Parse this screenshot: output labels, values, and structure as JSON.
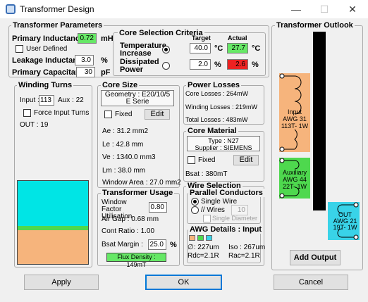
{
  "window": {
    "title": "Transformer Design",
    "minimize": "—",
    "maximize": "☐",
    "close": "✕"
  },
  "params": {
    "label": "Transformer Parameters",
    "primary_inductance_label": "Primary Inductance",
    "primary_inductance_value": "0.72",
    "primary_inductance_unit": "mH",
    "user_defined": "User Defined",
    "leakage_label": "Leakage Inductance",
    "leakage_value": "3.0",
    "leakage_unit": "%",
    "capacitance_label": "Primary Capacitance",
    "capacitance_value": "30",
    "capacitance_unit": "pF"
  },
  "criteria": {
    "label": "Core Selection Criteria",
    "target_header": "Target",
    "actual_header": "Actual",
    "temp_label": "Temperature Increase",
    "temp_target": "40.0",
    "temp_unit": "°C",
    "temp_actual": "27.7",
    "temp_actual_unit": "°C",
    "power_label": "Dissipated Power",
    "power_target": "2.0",
    "power_unit": "%",
    "power_actual": "2.6",
    "power_actual_unit": "%",
    "ok_color": "#66e866",
    "bad_color": "#ee2222"
  },
  "winding": {
    "label": "Winding Turns",
    "input_label": "Input :",
    "input_value": "113",
    "aux_label": "Aux : 22",
    "force_label": "Force Input Turns",
    "out_label": "OUT : 19"
  },
  "core_size": {
    "label": "Core Size",
    "geometry": "Geometry : E20/10/5",
    "serie": "E Serie",
    "fixed_label": "Fixed",
    "edit_label": "Edit",
    "ae": "Ae : 31.2 mm2",
    "le": "Le : 42.8 mm",
    "ve": "Ve : 1340.0 mm3",
    "lm": "Lm : 38.0 mm",
    "window_area": "Window Area : 27.0 mm2"
  },
  "losses": {
    "label": "Power Losses",
    "core": "Core Losses : 264mW",
    "winding": "Winding Losses : 219mW",
    "total": "Total Losses : 483mW"
  },
  "material": {
    "label": "Core Material",
    "type": "Type : N27",
    "supplier": "Supplier : SIEMENS",
    "fixed_label": "Fixed",
    "edit_label": "Edit",
    "bsat": "Bsat : 380mT"
  },
  "usage": {
    "label": "Transformer Usage",
    "wf_label": "Window Factor Utilisation",
    "wf_value": "0.80",
    "air_gap": "Air Gap : 0.68 mm",
    "cont_ratio": "Cont Ratio : 1.00",
    "bsat_margin_label": "Bsat Margin :",
    "bsat_margin_value": "25.0",
    "bsat_margin_unit": "%",
    "flux": "Flux Density : 149mT"
  },
  "wire": {
    "label": "Wire Selection",
    "parallel_label": "Parallel Conductors",
    "single_wire": "Single Wire",
    "wires_label": "// Wires",
    "wires_value": "10",
    "single_diameter": "Single Diameter",
    "awg_label": "AWG Details : Input",
    "awg_diam": "∅: 227um",
    "awg_iso": "Iso : 267um",
    "rdc": "Rdc=2.1R",
    "rac": "Rac=2.1R",
    "swatch_colors": [
      "#f6b47c",
      "#4ed84e",
      "#39d3e8"
    ]
  },
  "outlook": {
    "label": "Transformer Outlook",
    "input_lines": [
      "Input",
      "AWG 31",
      "113T- 1W"
    ],
    "aux_lines": [
      "Auxiliary",
      "AWG 44",
      "22T- 1W"
    ],
    "out_lines": [
      "OUT",
      "AWG 21",
      "19T- 1W"
    ],
    "input_color": "#f6b47c",
    "aux_color": "#4ed84e",
    "out_color": "#39d3e8",
    "add_output": "Add Output"
  },
  "window_fill": {
    "colors": [
      "#00e5e5",
      "#4ed84e",
      "#f6b47c"
    ]
  },
  "footer": {
    "apply": "Apply",
    "ok": "OK",
    "cancel": "Cancel"
  }
}
